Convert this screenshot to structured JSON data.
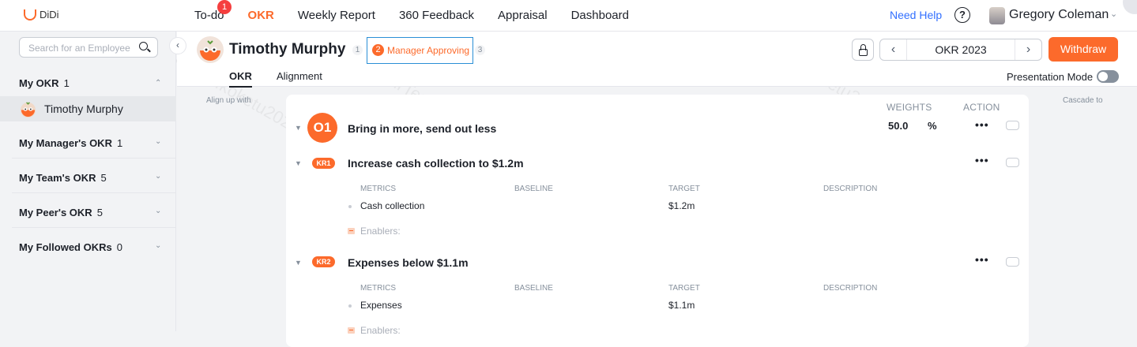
{
  "app": {
    "logo_text": "DiDi"
  },
  "nav": {
    "items": [
      {
        "label": "To-do",
        "badge": "1"
      },
      {
        "label": "OKR"
      },
      {
        "label": "Weekly Report"
      },
      {
        "label": "360 Feedback"
      },
      {
        "label": "Appraisal"
      },
      {
        "label": "Dashboard"
      }
    ],
    "active": "OKR",
    "help": "Need Help",
    "question": "?",
    "user": "Gregory Coleman"
  },
  "sidebar": {
    "search_placeholder": "Search for an Employee",
    "my_okr": {
      "label": "My OKR",
      "count": "1"
    },
    "selected_person": "Timothy Murphy",
    "sections": [
      {
        "label": "My Manager's OKR",
        "count": "1"
      },
      {
        "label": "My Team's OKR",
        "count": "5"
      },
      {
        "label": "My Peer's OKR",
        "count": "5"
      },
      {
        "label": "My Followed OKRs",
        "count": "0"
      }
    ]
  },
  "header": {
    "person": "Timothy Murphy",
    "steps": [
      "1",
      "2",
      "3"
    ],
    "status": "Manager Approving",
    "period": "OKR 2023",
    "withdraw": "Withdraw",
    "tabs": [
      "OKR",
      "Alignment"
    ],
    "presentation_mode": "Presentation Mode",
    "presentation_on": false
  },
  "labels": {
    "align_up": "Align up with",
    "cascade": "Cascade to"
  },
  "okr": {
    "col_weights": "WEIGHTS",
    "col_action": "ACTION",
    "objective": {
      "badge": "O1",
      "title": "Bring in more, send out less",
      "weight": "50.0",
      "unit": "%"
    },
    "metric_headers": [
      "METRICS",
      "BASELINE",
      "TARGET",
      "DESCRIPTION"
    ],
    "enablers": "Enablers:",
    "more": "•••",
    "key_results": [
      {
        "badge": "KR1",
        "title": "Increase cash collection to $1.2m",
        "metric": "Cash collection",
        "baseline": "",
        "target": "$1.2m",
        "description": ""
      },
      {
        "badge": "KR2",
        "title": "Expenses below $1.1m",
        "metric": "Expenses",
        "baseline": "",
        "target": "$1.1m",
        "description": ""
      }
    ]
  },
  "colors": {
    "accent": "#fc6a2b",
    "link": "#3370ff",
    "badge": "#f53f3f",
    "focus": "#2a8fd6"
  }
}
